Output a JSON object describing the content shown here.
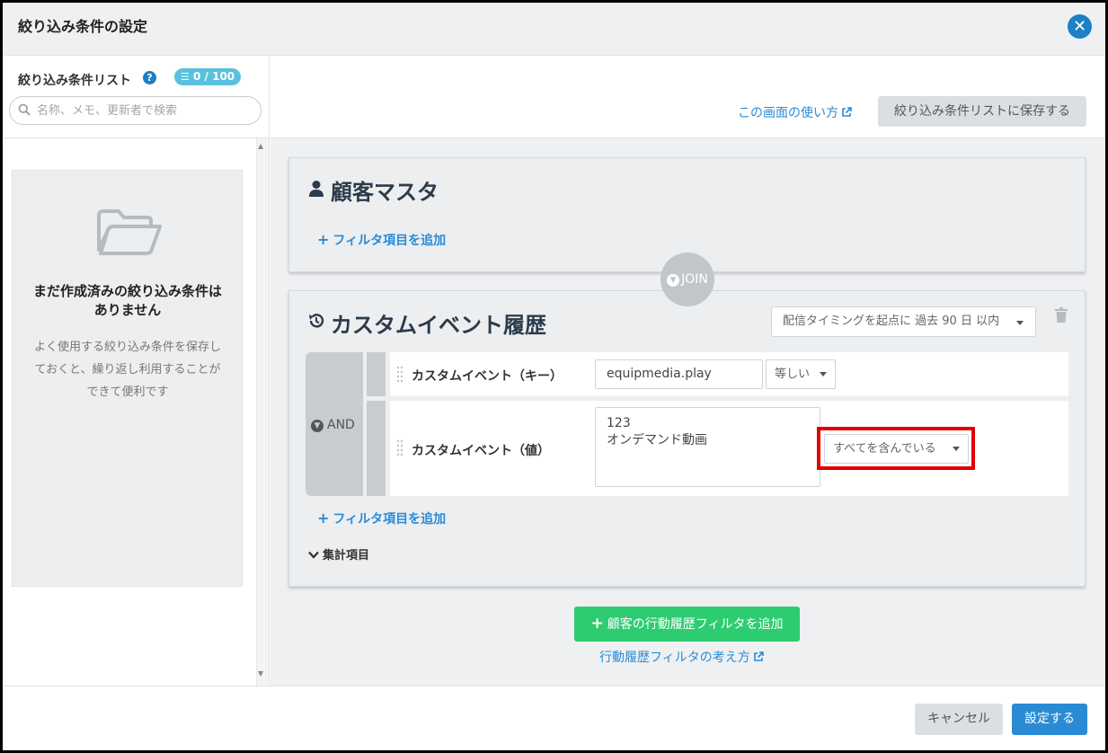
{
  "header": {
    "title": "絞り込み条件の設定",
    "close_icon": "close-icon"
  },
  "sidebar": {
    "list_title": "絞り込み条件リスト",
    "count_badge": "0 / 100",
    "search_placeholder": "名称、メモ、更新者で検索",
    "empty_title": "まだ作成済みの絞り込み条件はありません",
    "empty_desc": "よく使用する絞り込み条件を保存しておくと、繰り返し利用することができて便利です"
  },
  "toolbar": {
    "howto_link": "この画面の使い方",
    "save_label": "絞り込み条件リストに保存する"
  },
  "panels": {
    "customer": {
      "title": "顧客マスタ",
      "add_filter": "フィルタ項目を追加"
    },
    "join_label": "JOIN",
    "event": {
      "title": "カスタムイベント履歴",
      "timing_select": "配信タイミングを起点に 過去 90 日 以内",
      "logic": "AND",
      "rows": [
        {
          "label": "カスタムイベント（キー）",
          "value": "equipmedia.play",
          "operator": "等しい"
        },
        {
          "label": "カスタムイベント（値）",
          "value_line1": "123",
          "value_line2": "オンデマンド動画",
          "operator": "すべてを含んでいる"
        }
      ],
      "add_filter": "フィルタ項目を追加",
      "aggregate": "集計項目"
    }
  },
  "actions": {
    "add_action_filter": "顧客の行動履歴フィルタを追加",
    "concept_link": "行動履歴フィルタの考え方"
  },
  "footer": {
    "cancel_label": "キャンセル",
    "submit_label": "設定する"
  },
  "colors": {
    "primary": "#2a8bd5",
    "success": "#2ecc71",
    "highlight": "#e00000",
    "badge": "#5bc0de"
  }
}
